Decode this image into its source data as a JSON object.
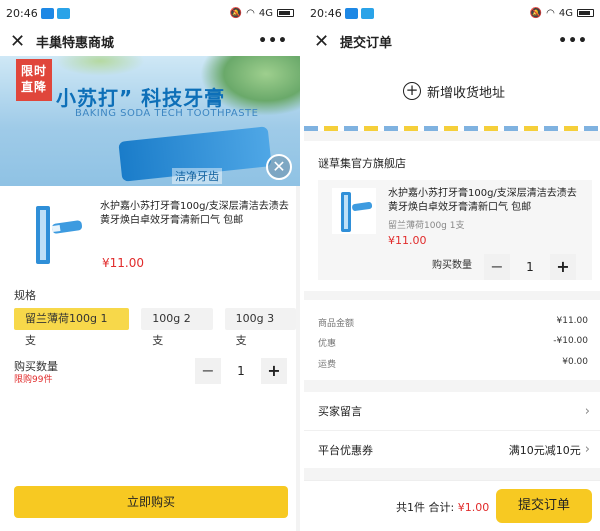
{
  "left": {
    "status": {
      "time": "20:46",
      "network": "4G"
    },
    "window_title": "丰巢特惠商城",
    "banner": {
      "tag_line1": "限时",
      "tag_line2": "直降",
      "headline": "小苏打” 科技牙膏",
      "subline": "BAKING SODA TECH TOOTHPASTE",
      "clean_text": "洁净牙齿"
    },
    "product": {
      "name": "水护嘉小苏打牙膏100g/支深层清洁去渍去黄牙焕白卓效牙膏清新口气 包邮",
      "price": "¥11.00"
    },
    "spec": {
      "label": "规格",
      "options": [
        "留兰薄荷100g 1支",
        "100g 2支",
        "100g 3支"
      ]
    },
    "quantity": {
      "label": "购买数量",
      "limit": "限购99件",
      "value": "1",
      "minus": "−",
      "plus": "+"
    },
    "buy_label": "立即购买"
  },
  "right": {
    "status": {
      "time": "20:46",
      "network": "4G"
    },
    "window_title": "提交订单",
    "add_address": "新增收货地址",
    "shop_name": "谜草集官方旗舰店",
    "item": {
      "name": "水护嘉小苏打牙膏100g/支深层清洁去渍去黄牙焕白卓效牙膏清新口气 包邮",
      "spec": "留兰薄荷100g 1支",
      "price": "¥11.00",
      "qty_label": "购买数量",
      "qty": "1",
      "minus": "−",
      "plus": "+"
    },
    "summary": [
      {
        "label": "商品金额",
        "value": "¥11.00"
      },
      {
        "label": "优惠",
        "value": "-¥10.00"
      },
      {
        "label": "运费",
        "value": "¥0.00"
      }
    ],
    "message_label": "买家留言",
    "coupon": {
      "label": "平台优惠券",
      "value": "满10元减10元"
    },
    "footer": {
      "count": "共1件 合计:",
      "amount": "¥1.00",
      "submit_label": "提交订单"
    }
  },
  "colors": {
    "accent_yellow": "#f7c922",
    "price_red": "#e12c2c",
    "brand_blue": "#0d6fb8"
  }
}
